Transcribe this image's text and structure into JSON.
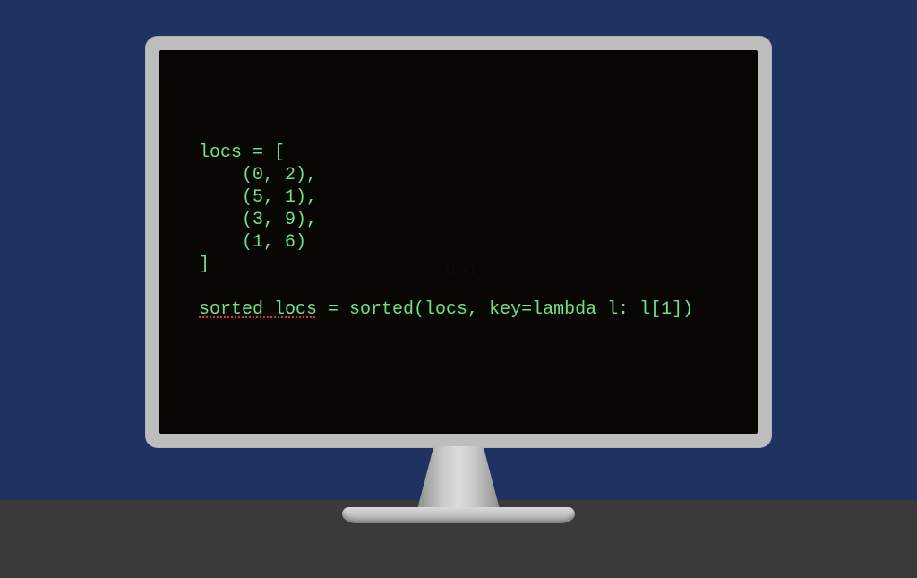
{
  "code": {
    "line1": "locs = [",
    "line2": "    (0, 2),",
    "line3": "    (5, 1),",
    "line4": "    (3, 9),",
    "line5": "    (1, 6)",
    "line6": "]",
    "blank": "",
    "sorted_ident": "sorted_locs",
    "sorted_rest": " = sorted(locs, key=lambda l: l[1])"
  },
  "watermark": "Text"
}
